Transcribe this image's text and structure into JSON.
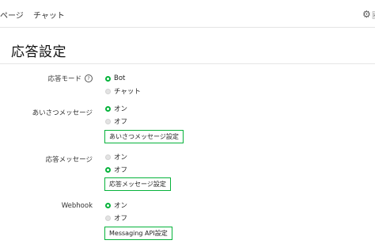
{
  "nav": {
    "tabs": [
      {
        "label": "ページ"
      },
      {
        "label": "チャット"
      }
    ],
    "right_icon": "gear-icon",
    "right_cut_text": "🖼"
  },
  "page": {
    "title": "応答設定"
  },
  "settings": [
    {
      "label": "応答モード",
      "help_icon": "?",
      "options": [
        {
          "label": "Bot",
          "selected": true
        },
        {
          "label": "チャット",
          "selected": false
        }
      ]
    },
    {
      "label": "あいさつメッセージ",
      "options": [
        {
          "label": "オン",
          "selected": true
        },
        {
          "label": "オフ",
          "selected": false
        }
      ],
      "button": "あいさつメッセージ設定"
    },
    {
      "label": "応答メッセージ",
      "options": [
        {
          "label": "オン",
          "selected": false
        },
        {
          "label": "オフ",
          "selected": true
        }
      ],
      "button": "応答メッセージ設定"
    },
    {
      "label": "Webhook",
      "options": [
        {
          "label": "オン",
          "selected": true
        },
        {
          "label": "オフ",
          "selected": false
        }
      ],
      "button": "Messaging API設定"
    }
  ],
  "colors": {
    "accent": "#06b33b",
    "radio_off": "#e3e3e3",
    "divider": "#e6e6e6"
  }
}
